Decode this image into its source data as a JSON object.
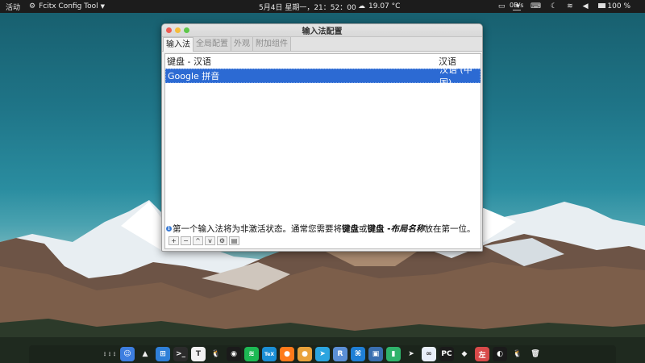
{
  "topbar": {
    "activities": "活动",
    "app_name": "Fcitx Config Tool",
    "clock": "5月4日 星期一，21：52：00",
    "weather": "19.07 °C",
    "net_speed": "0B/s",
    "battery": "100 %"
  },
  "window": {
    "title": "输入法配置",
    "tabs": [
      {
        "label": "输入法"
      },
      {
        "label": "全局配置"
      },
      {
        "label": "外观"
      },
      {
        "label": "附加组件"
      }
    ],
    "rows": [
      {
        "name": "键盘 - 汉语",
        "language": "汉语"
      },
      {
        "name": "Google 拼音",
        "language": "汉语 (中国)"
      }
    ],
    "hint": {
      "p1": "第一个输入法将为非激活状态。通常您需要将",
      "b1": "键盘",
      "p2": "或",
      "b2": "键盘 - ",
      "i1": "布局名称",
      "p3": "放在第一位。"
    },
    "toolbar": [
      {
        "icon": "plus-icon",
        "glyph": "+"
      },
      {
        "icon": "minus-icon",
        "glyph": "−"
      },
      {
        "icon": "arrow-up-icon",
        "glyph": "^"
      },
      {
        "icon": "arrow-down-icon",
        "glyph": "v"
      },
      {
        "icon": "gear-icon",
        "glyph": "⚙"
      },
      {
        "icon": "keyboard-icon",
        "glyph": "▤"
      }
    ]
  },
  "dock": {
    "icons": [
      {
        "name": "app-grid-icon",
        "glyph": "⋮⋮⋮",
        "color": "#00000000"
      },
      {
        "name": "finder-icon",
        "glyph": "☺",
        "color": "#3d7ee0"
      },
      {
        "name": "vlc-icon",
        "glyph": "▲",
        "color": "#00000000"
      },
      {
        "name": "calculator-icon",
        "glyph": "⊞",
        "color": "#2f7fd8"
      },
      {
        "name": "terminal-icon",
        "glyph": ">_",
        "color": "#2b2b2b"
      },
      {
        "name": "typora-icon",
        "glyph": "T",
        "color": "#f2f2f2"
      },
      {
        "name": "qq-icon",
        "glyph": "🐧",
        "color": "#00000000"
      },
      {
        "name": "davinci-resolve-icon",
        "glyph": "◉",
        "color": "#1a1a1a"
      },
      {
        "name": "spotify-icon",
        "glyph": "≋",
        "color": "#1db954"
      },
      {
        "name": "tex-icon",
        "glyph": "TeX",
        "color": "#1b8fd6"
      },
      {
        "name": "firefox-icon",
        "glyph": "●",
        "color": "#ff7a1a"
      },
      {
        "name": "chrome-icon",
        "glyph": "●",
        "color": "#e9a23b"
      },
      {
        "name": "telegram-icon",
        "glyph": "➤",
        "color": "#2ca5e0"
      },
      {
        "name": "r-studio-icon",
        "glyph": "R",
        "color": "#5b8fd6"
      },
      {
        "name": "vscode-icon",
        "glyph": "⌘",
        "color": "#1f7fd6"
      },
      {
        "name": "screenshot-icon",
        "glyph": "▣",
        "color": "#3a6fb0"
      },
      {
        "name": "charts-icon",
        "glyph": "▮",
        "color": "#2fb36b"
      },
      {
        "name": "paper-plane-icon",
        "glyph": "➤",
        "color": "#00000000"
      },
      {
        "name": "baidu-netdisk-icon",
        "glyph": "∞",
        "color": "#e8eef8"
      },
      {
        "name": "pycharm-icon",
        "glyph": "PC",
        "color": "#1a1a1a"
      },
      {
        "name": "inkscape-icon",
        "glyph": "◆",
        "color": "#00000000"
      },
      {
        "name": "pdf-reader-icon",
        "glyph": "左",
        "color": "#d84a4a"
      },
      {
        "name": "obs-icon",
        "glyph": "◐",
        "color": "#1a1a1a"
      },
      {
        "name": "linux-penguin-icon",
        "glyph": "🐧",
        "color": "#00000000"
      },
      {
        "name": "trash-icon",
        "glyph": "🗑",
        "color": "#00000000"
      }
    ]
  }
}
